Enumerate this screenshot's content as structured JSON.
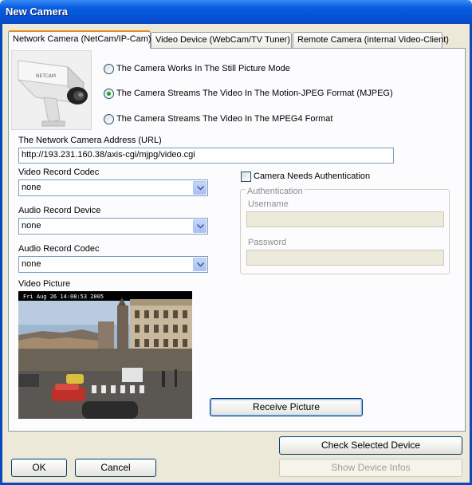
{
  "window": {
    "title": "New Camera"
  },
  "tabs": [
    {
      "label": "Network Camera (NetCam/IP-Cam)",
      "active": true
    },
    {
      "label": "Video Device (WebCam/TV Tuner)",
      "active": false
    },
    {
      "label": "Remote Camera (internal Video-Client)",
      "active": false
    }
  ],
  "camera_image": {
    "brand_text": "NETCAM"
  },
  "mode": {
    "options": [
      {
        "label": "The Camera Works In The Still Picture Mode",
        "selected": false
      },
      {
        "label": "The Camera Streams The Video In The Motion-JPEG Format (MJPEG)",
        "selected": true
      },
      {
        "label": "The Camera Streams The Video In The MPEG4 Format",
        "selected": false
      }
    ]
  },
  "url": {
    "label": "The Network Camera Address (URL)",
    "value": "http://193.231.160.38/axis-cgi/mjpg/video.cgi"
  },
  "video_codec": {
    "label": "Video Record Codec",
    "value": "none"
  },
  "audio_device": {
    "label": "Audio Record Device",
    "value": "none"
  },
  "audio_codec": {
    "label": "Audio Record Codec",
    "value": "none"
  },
  "auth": {
    "checkbox_label": "Camera Needs Authentication",
    "checked": false,
    "group_title": "Authentication",
    "username_label": "Username",
    "username_value": "",
    "password_label": "Password",
    "password_value": ""
  },
  "video_picture": {
    "label": "Video Picture",
    "timestamp": "Fri Aug 26  14:08:53  2005"
  },
  "buttons": {
    "receive": "Receive Picture",
    "check_device": "Check Selected Device",
    "show_infos": "Show Device Infos",
    "ok": "OK",
    "cancel": "Cancel"
  },
  "colors": {
    "title_bar": "#0a5fe0",
    "dialog_bg": "#ece9d8",
    "panel_bg": "#fcfcfe",
    "radio_selected": "#21a121",
    "tab_highlight": "#e68b2c"
  }
}
